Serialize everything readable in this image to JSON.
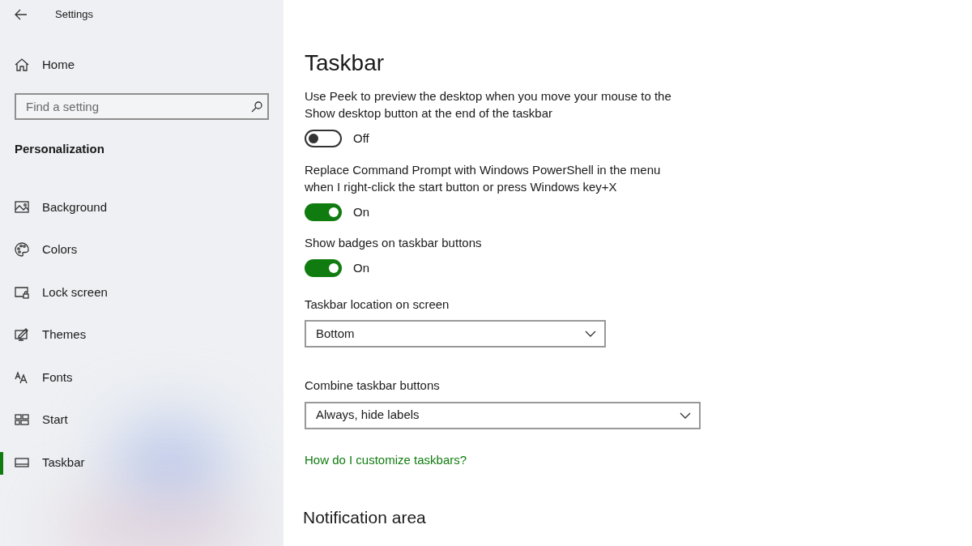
{
  "window": {
    "title": "Settings"
  },
  "sidebar": {
    "home": "Home",
    "search": {
      "placeholder": "Find a setting"
    },
    "section": "Personalization",
    "items": [
      {
        "label": "Background",
        "kind": "image",
        "selected": false
      },
      {
        "label": "Colors",
        "kind": "palette",
        "selected": false
      },
      {
        "label": "Lock screen",
        "kind": "lock",
        "selected": false
      },
      {
        "label": "Themes",
        "kind": "themes",
        "selected": false
      },
      {
        "label": "Fonts",
        "kind": "fonts",
        "selected": false
      },
      {
        "label": "Start",
        "kind": "start",
        "selected": false
      },
      {
        "label": "Taskbar",
        "kind": "taskbar",
        "selected": true
      }
    ]
  },
  "page": {
    "title": "Taskbar",
    "settings": [
      {
        "kind": "toggle",
        "label": "Use Peek to preview the desktop when you move your mouse to the Show desktop button at the end of the taskbar",
        "on": false,
        "state_text": "Off"
      },
      {
        "kind": "toggle",
        "label": "Replace Command Prompt with Windows PowerShell in the menu when I right-click the start button or press Windows key+X",
        "on": true,
        "state_text": "On"
      },
      {
        "kind": "toggle",
        "label": "Show badges on taskbar buttons",
        "on": true,
        "state_text": "On"
      },
      {
        "kind": "dropdown",
        "label": "Taskbar location on screen",
        "value": "Bottom",
        "wide": false
      },
      {
        "kind": "dropdown",
        "label": "Combine taskbar buttons",
        "value": "Always, hide labels",
        "wide": true
      }
    ],
    "link": "How do I customize taskbars?",
    "section": "Notification area"
  }
}
